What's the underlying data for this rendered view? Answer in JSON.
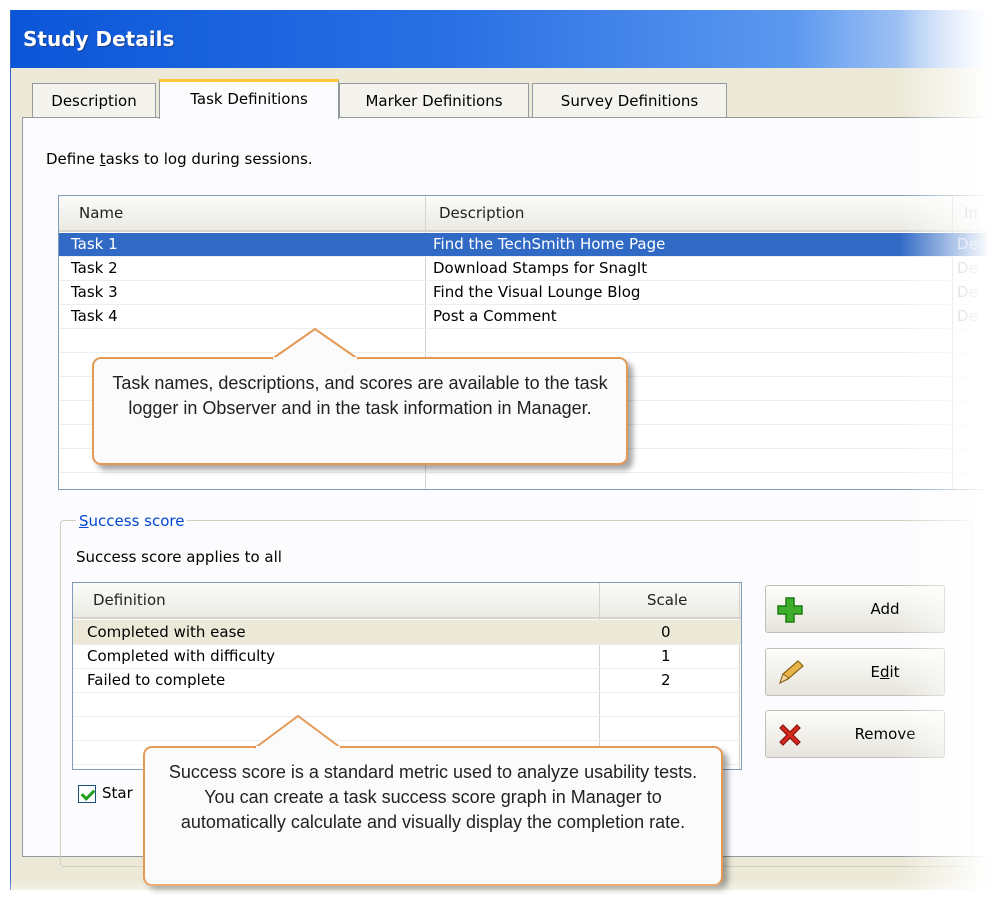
{
  "window": {
    "title": "Study Details"
  },
  "tabs": [
    {
      "label": "Description"
    },
    {
      "label": "Task Definitions"
    },
    {
      "label": "Marker Definitions"
    },
    {
      "label": "Survey Definitions"
    }
  ],
  "task_panel": {
    "instruction_pre": "Define ",
    "instruction_accel": "t",
    "instruction_post": "asks to log during sessions.",
    "columns": [
      "Name",
      "Description",
      "In"
    ],
    "rows": [
      {
        "name": "Task 1",
        "description": "Find the TechSmith Home Page",
        "third": "De",
        "selected": true
      },
      {
        "name": "Task 2",
        "description": "Download Stamps for SnagIt",
        "third": "De",
        "selected": false
      },
      {
        "name": "Task 3",
        "description": "Find the Visual Lounge Blog",
        "third": "De",
        "selected": false
      },
      {
        "name": "Task 4",
        "description": "Post a Comment",
        "third": "De",
        "selected": false
      }
    ]
  },
  "success_score": {
    "group_label": "Success score",
    "group_label_accel": "S",
    "group_label_rest": "uccess score",
    "applies_text": "Success score applies to all",
    "columns": [
      "Definition",
      "Scale"
    ],
    "rows": [
      {
        "definition": "Completed with ease",
        "scale": "0"
      },
      {
        "definition": "Completed with difficulty",
        "scale": "1"
      },
      {
        "definition": "Failed to complete",
        "scale": "2"
      }
    ],
    "buttons": {
      "add": "Add",
      "edit_pre": "E",
      "edit_accel": "d",
      "edit_post": "it",
      "remove": "Remove"
    },
    "checkbox_label_visible": "Star",
    "checkbox_checked": true
  },
  "callouts": {
    "tasks": "Task names, descriptions, and scores are available to the task logger in Observer and in the task information in Manager.",
    "score": "Success score is a standard metric used to analyze usability tests. You can create a task success score graph in Manager to automatically calculate and visually display the completion rate."
  },
  "colors": {
    "selection": "#316ac5",
    "callout_border": "#e49a55",
    "title_bar": "#0b56d8"
  }
}
